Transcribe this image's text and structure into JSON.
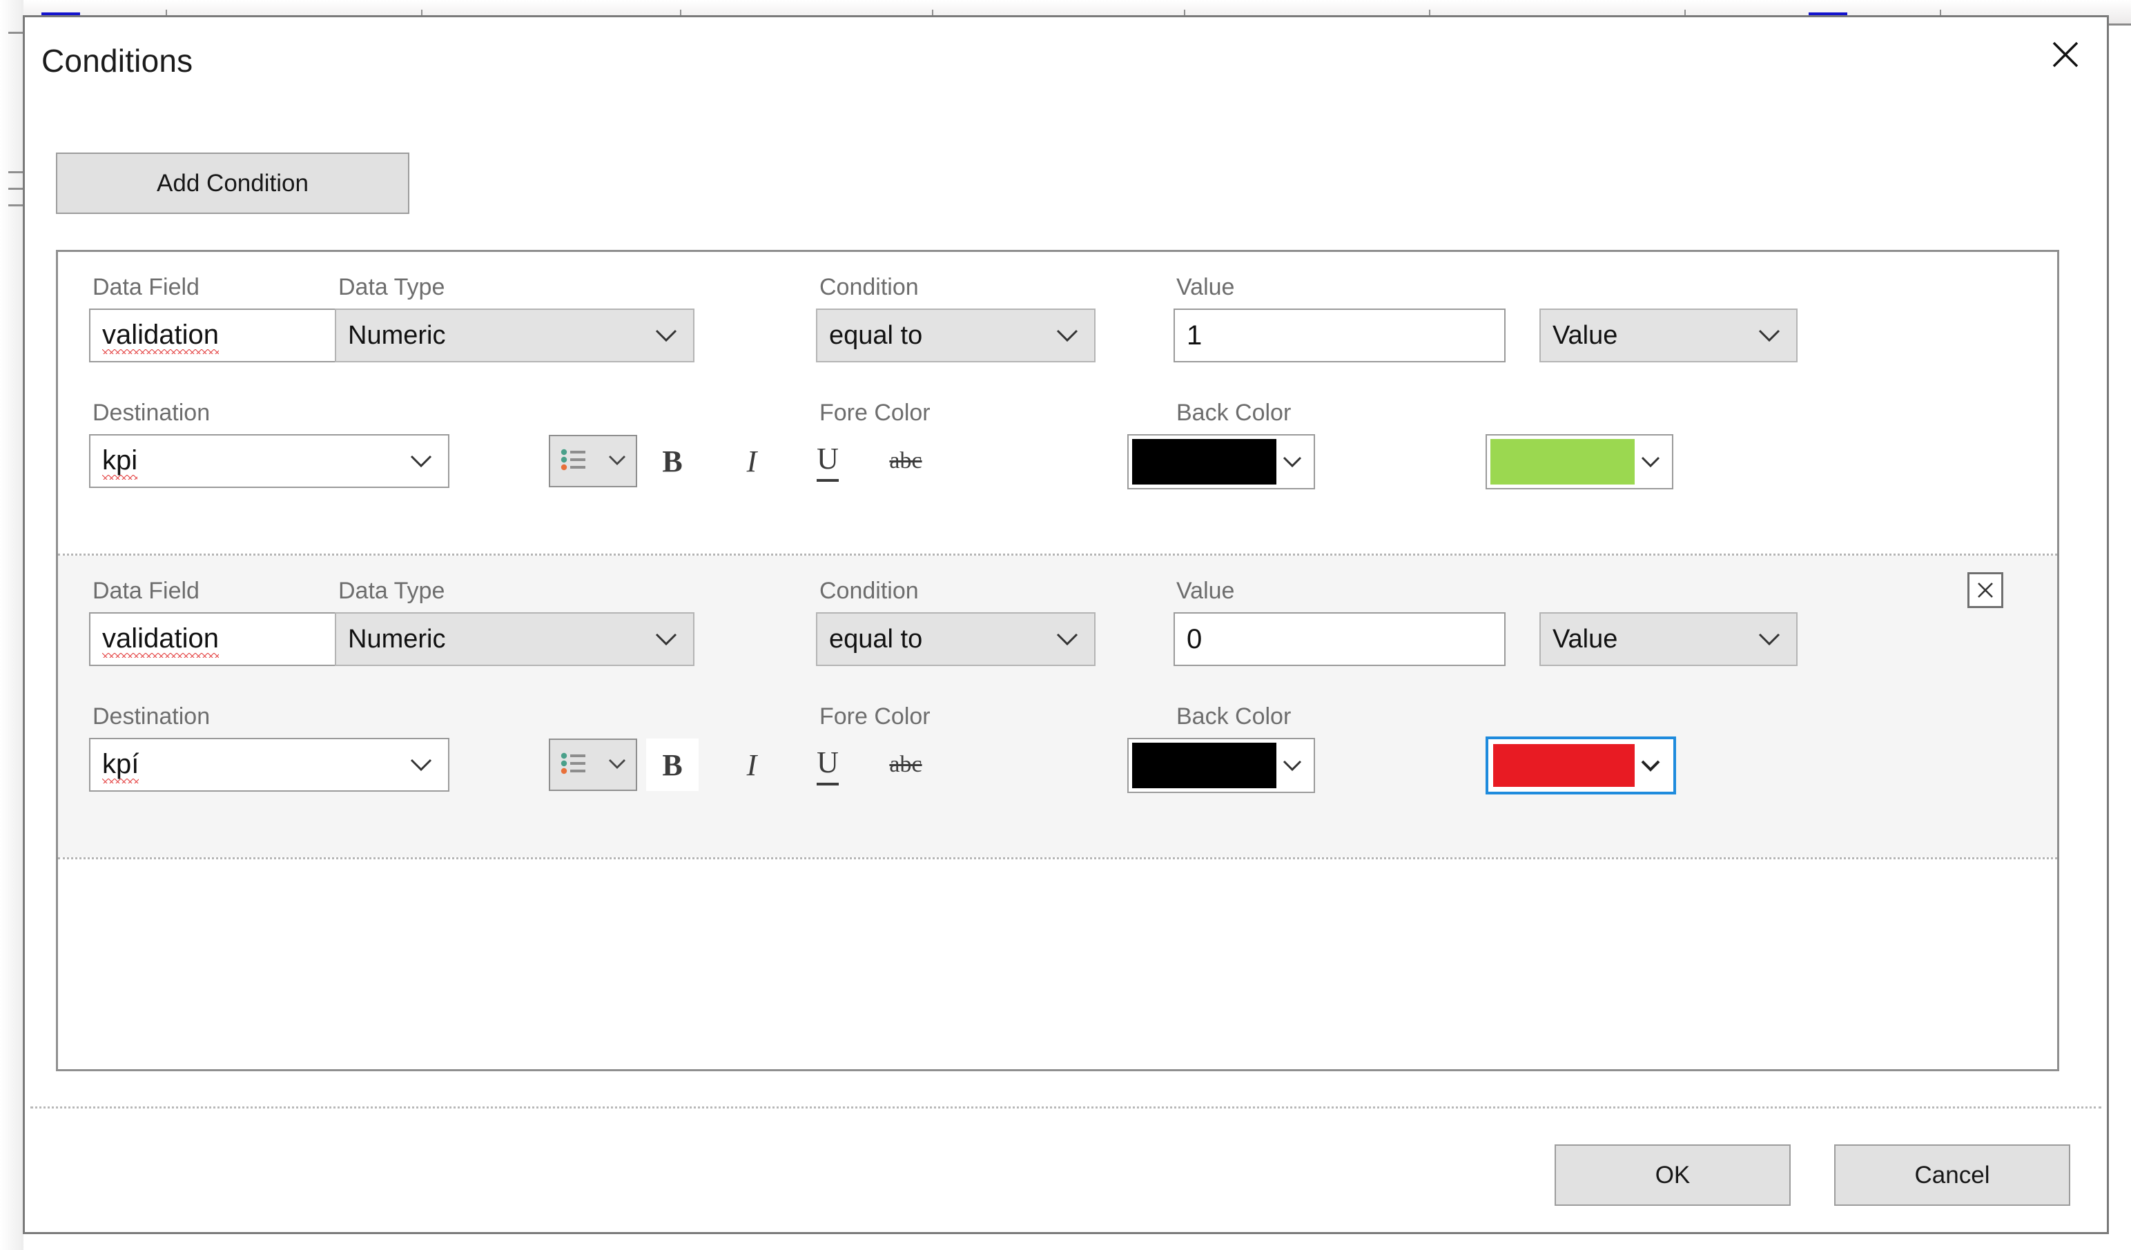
{
  "dialog": {
    "title": "Conditions",
    "close_icon": "close-icon",
    "add_condition_label": "Add Condition",
    "ok_label": "OK",
    "cancel_label": "Cancel"
  },
  "labels": {
    "data_field": "Data Field",
    "data_type": "Data Type",
    "condition": "Condition",
    "value": "Value",
    "destination": "Destination",
    "fore_color": "Fore Color",
    "back_color": "Back Color"
  },
  "format_toolbar": {
    "bullets_icon": "bullet-list-icon",
    "bold_label": "B",
    "italic_label": "I",
    "underline_label": "U",
    "strikethrough_label": "abc"
  },
  "colors": {
    "fore_black": "#000000",
    "back_green": "#9BD850",
    "back_red": "#E81B23",
    "focus_blue": "#1F8BDD",
    "label_gray": "#6D6D6D",
    "spellcheck_red": "#E33D3D",
    "tabstop_blue": "#1414CD"
  },
  "conditions": [
    {
      "data_field": "validation",
      "data_field_misspelled": true,
      "data_type": "Numeric",
      "condition": "equal to",
      "value": "1",
      "value_kind": "Value",
      "destination": "kpi",
      "destination_misspelled": true,
      "bold_active": false,
      "italic_active": false,
      "underline_active": false,
      "strikethrough_active": false,
      "fore_color": "#000000",
      "back_color": "#9BD850",
      "back_color_focused": false,
      "deletable": false
    },
    {
      "data_field": "validation",
      "data_field_misspelled": true,
      "data_type": "Numeric",
      "condition": "equal to",
      "value": "0",
      "value_kind": "Value",
      "destination": "kpí",
      "destination_misspelled": true,
      "bold_active": true,
      "italic_active": false,
      "underline_active": false,
      "strikethrough_active": false,
      "fore_color": "#000000",
      "back_color": "#E81B23",
      "back_color_focused": true,
      "deletable": true,
      "delete_icon": "close-icon"
    }
  ]
}
